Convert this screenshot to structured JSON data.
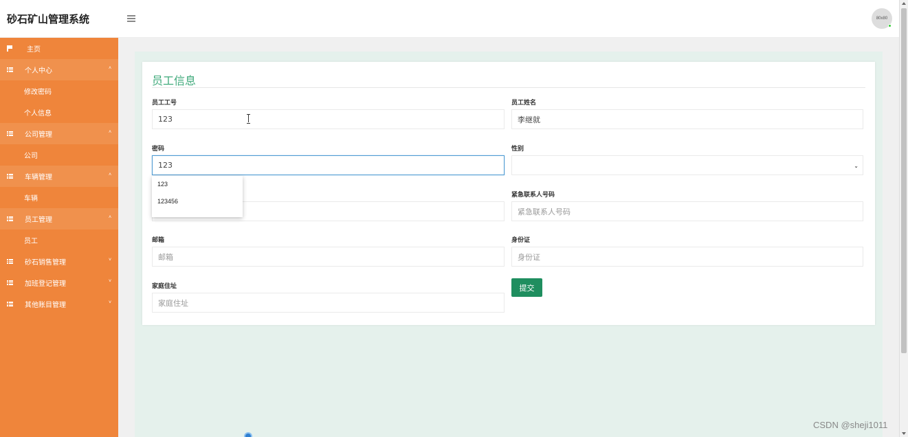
{
  "header": {
    "brand": "砂石矿山管理系统",
    "avatar_text": "80x80"
  },
  "sidebar": {
    "items": [
      {
        "label": "主页",
        "type": "home"
      },
      {
        "label": "个人中心",
        "type": "group"
      },
      {
        "label": "修改密码",
        "type": "sub"
      },
      {
        "label": "个人信息",
        "type": "sub"
      },
      {
        "label": "公司管理",
        "type": "group"
      },
      {
        "label": "公司",
        "type": "sub"
      },
      {
        "label": "车辆管理",
        "type": "group"
      },
      {
        "label": "车辆",
        "type": "sub"
      },
      {
        "label": "员工管理",
        "type": "group"
      },
      {
        "label": "员工",
        "type": "sub"
      },
      {
        "label": "砂石销售管理",
        "type": "group"
      },
      {
        "label": "加班登记管理",
        "type": "group"
      },
      {
        "label": "其他账目管理",
        "type": "group"
      }
    ]
  },
  "form": {
    "title": "员工信息",
    "employee_id": {
      "label": "员工工号",
      "value": "123"
    },
    "employee_name": {
      "label": "员工姓名",
      "value": "李继就"
    },
    "password": {
      "label": "密码",
      "value": "123"
    },
    "gender": {
      "label": "性别",
      "value": ""
    },
    "phone": {
      "value": ""
    },
    "emergency_phone": {
      "label": "紧急联系人号码",
      "placeholder": "紧急联系人号码"
    },
    "email": {
      "label": "邮箱",
      "placeholder": "邮箱"
    },
    "id_card": {
      "label": "身份证",
      "placeholder": "身份证"
    },
    "address": {
      "label": "家庭住址",
      "placeholder": "家庭住址"
    },
    "submit": "提交"
  },
  "autocomplete": [
    "123",
    "123456"
  ],
  "watermark": "CSDN @sheji1011",
  "colors": {
    "sidebar": "#ef853b",
    "title": "#3ea97a",
    "submit": "#1f8e5f"
  }
}
